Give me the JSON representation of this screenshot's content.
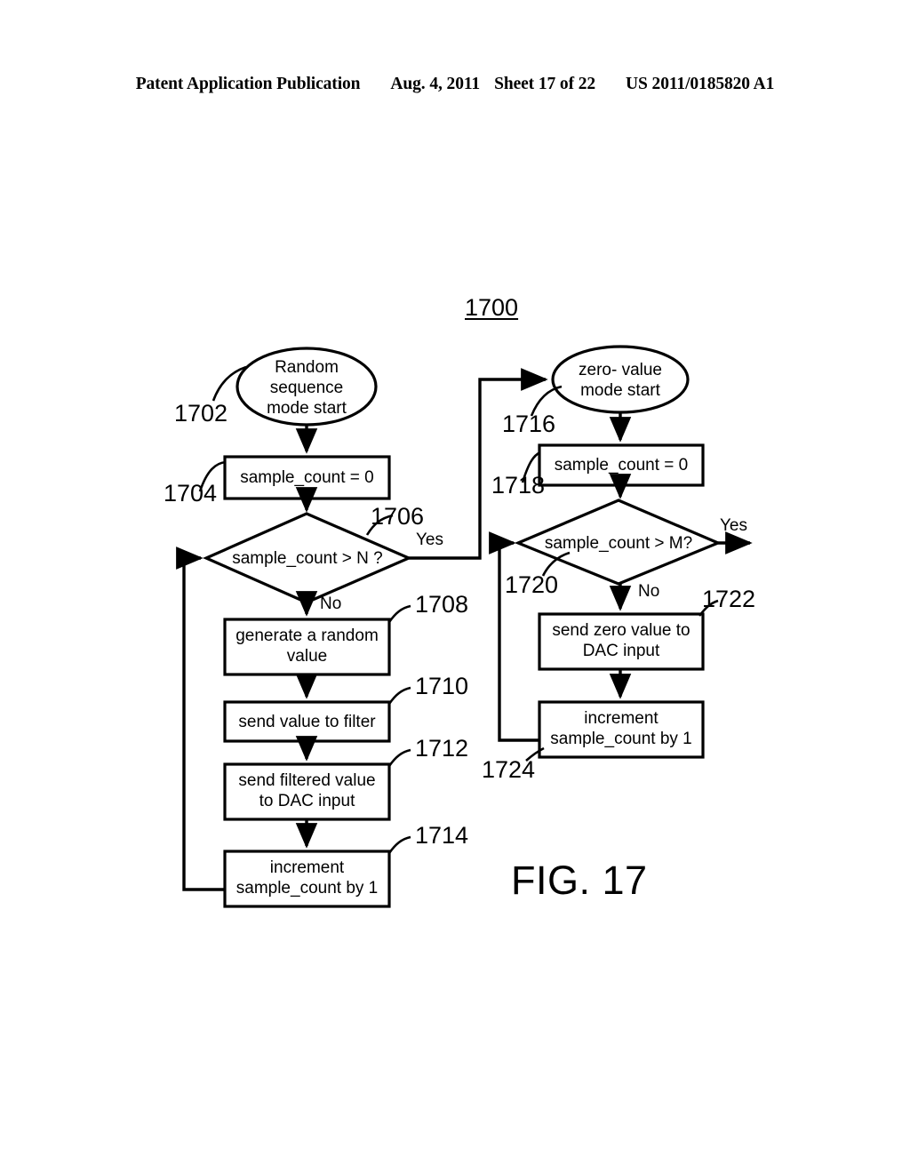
{
  "header": {
    "publication": "Patent Application Publication",
    "date": "Aug. 4, 2011",
    "sheet": "Sheet 17 of 22",
    "patent_number": "US 2011/0185820 A1"
  },
  "figure": {
    "caption": "FIG. 17",
    "diagram_number": "1700"
  },
  "diagram": {
    "type": "flowchart",
    "nodes": [
      {
        "ref": "1702",
        "shape": "ellipse",
        "text": "Random\nsequence\nmode start",
        "branch": "left"
      },
      {
        "ref": "1704",
        "shape": "rect",
        "text": "sample_count = 0",
        "branch": "left"
      },
      {
        "ref": "1706",
        "shape": "diamond",
        "text": "sample_count > N ?",
        "branch": "left"
      },
      {
        "ref": "1708",
        "shape": "rect",
        "text": "generate a random\nvalue",
        "branch": "left"
      },
      {
        "ref": "1710",
        "shape": "rect",
        "text": "send value to filter",
        "branch": "left"
      },
      {
        "ref": "1712",
        "shape": "rect",
        "text": "send filtered value\nto DAC input",
        "branch": "left"
      },
      {
        "ref": "1714",
        "shape": "rect",
        "text": "increment\nsample_count by 1",
        "branch": "left"
      },
      {
        "ref": "1716",
        "shape": "ellipse",
        "text": "zero- value\nmode start",
        "branch": "right"
      },
      {
        "ref": "1718",
        "shape": "rect",
        "text": "sample_count = 0",
        "branch": "right"
      },
      {
        "ref": "1720",
        "shape": "diamond",
        "text": "sample_count > M?",
        "branch": "right"
      },
      {
        "ref": "1722",
        "shape": "rect",
        "text": "send zero value to\nDAC input",
        "branch": "right"
      },
      {
        "ref": "1724",
        "shape": "rect",
        "text": "increment\nsample_count by 1",
        "branch": "right"
      }
    ],
    "edge_labels": {
      "left_yes": "Yes",
      "left_no": "No",
      "right_yes": "Yes",
      "right_no": "No"
    }
  },
  "colors": {
    "ink": "#000000",
    "paper": "#ffffff"
  }
}
